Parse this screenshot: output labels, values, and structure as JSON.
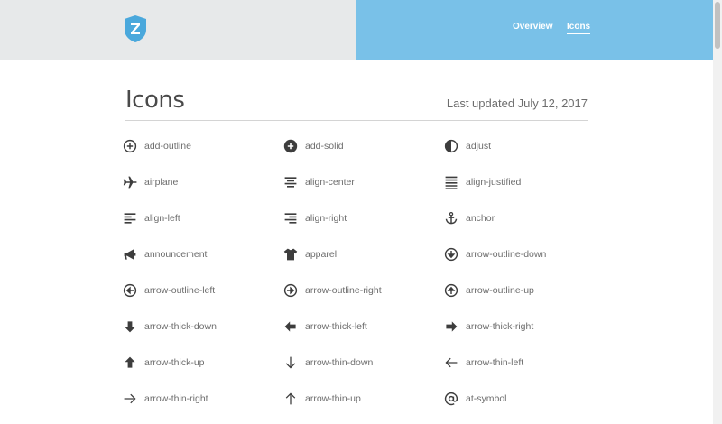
{
  "header": {
    "logo_icon": "shield-z-logo",
    "nav": [
      {
        "label": "Overview"
      },
      {
        "label": "Icons"
      }
    ]
  },
  "page": {
    "title": "Icons",
    "last_updated": "Last updated July 12, 2017"
  },
  "icons": [
    {
      "name": "add-outline",
      "icon": "plus-circle-outline"
    },
    {
      "name": "add-solid",
      "icon": "plus-circle-solid"
    },
    {
      "name": "adjust",
      "icon": "half-circle"
    },
    {
      "name": "airplane",
      "icon": "airplane"
    },
    {
      "name": "align-center",
      "icon": "align-center"
    },
    {
      "name": "align-justified",
      "icon": "align-justified"
    },
    {
      "name": "align-left",
      "icon": "align-left"
    },
    {
      "name": "align-right",
      "icon": "align-right"
    },
    {
      "name": "anchor",
      "icon": "anchor"
    },
    {
      "name": "announcement",
      "icon": "megaphone"
    },
    {
      "name": "apparel",
      "icon": "tshirt"
    },
    {
      "name": "arrow-outline-down",
      "icon": "arrow-circle-down"
    },
    {
      "name": "arrow-outline-left",
      "icon": "arrow-circle-left"
    },
    {
      "name": "arrow-outline-right",
      "icon": "arrow-circle-right"
    },
    {
      "name": "arrow-outline-up",
      "icon": "arrow-circle-up"
    },
    {
      "name": "arrow-thick-down",
      "icon": "thick-arrow-down"
    },
    {
      "name": "arrow-thick-left",
      "icon": "thick-arrow-left"
    },
    {
      "name": "arrow-thick-right",
      "icon": "thick-arrow-right"
    },
    {
      "name": "arrow-thick-up",
      "icon": "thick-arrow-up"
    },
    {
      "name": "arrow-thin-down",
      "icon": "thin-arrow-down"
    },
    {
      "name": "arrow-thin-left",
      "icon": "thin-arrow-left"
    },
    {
      "name": "arrow-thin-right",
      "icon": "thin-arrow-right"
    },
    {
      "name": "arrow-thin-up",
      "icon": "thin-arrow-up"
    },
    {
      "name": "at-symbol",
      "icon": "at-sign"
    }
  ],
  "colors": {
    "header_left": "#e7e9ea",
    "header_right": "#79c1e8",
    "logo": "#4aa8dc",
    "icon": "#3d3d3d",
    "text": "#6d6d6d"
  }
}
